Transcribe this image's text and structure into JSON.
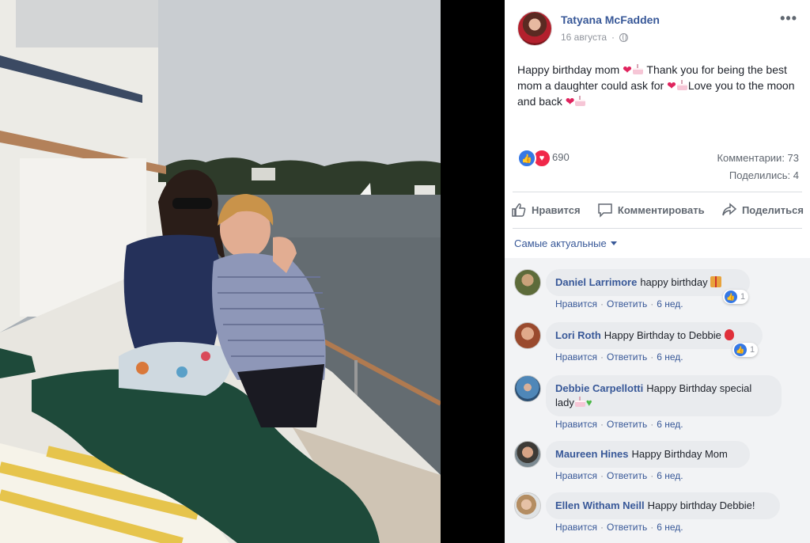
{
  "post": {
    "author": "Tatyana McFadden",
    "date": "16 августа",
    "text_segments": {
      "s1": "Happy birthday mom ",
      "s2": " Thank you for being the best mom a daughter could ask for ",
      "s3": "Love you to the moon and back "
    },
    "reaction_count": "690",
    "comments_label": "Комментарии: 73",
    "shares_label": "Поделились: 4"
  },
  "actions": {
    "like": "Нравится",
    "comment": "Комментировать",
    "share": "Поделиться"
  },
  "sort_label": "Самые актуальные",
  "comments": [
    {
      "author": "Daniel Larrimore",
      "text": "happy birthday",
      "like": "Нравится",
      "reply": "Ответить",
      "sep": "·",
      "time": "6 нед.",
      "reactions": "1"
    },
    {
      "author": "Lori Roth",
      "text": "Happy Birthday to Debbie",
      "like": "Нравится",
      "reply": "Ответить",
      "sep": "·",
      "time": "6 нед.",
      "reactions": "1"
    },
    {
      "author": "Debbie Carpellotti",
      "text": "Happy Birthday special lady",
      "like": "Нравится",
      "reply": "Ответить",
      "sep": "·",
      "time": "6 нед."
    },
    {
      "author": "Maureen Hines",
      "text": "Happy Birthday Mom",
      "like": "Нравится",
      "reply": "Ответить",
      "sep": "·",
      "time": "6 нед."
    },
    {
      "author": "Ellen Witham Neill",
      "text": "Happy birthday Debbie!",
      "like": "Нравится",
      "reply": "Ответить",
      "sep": "·",
      "time": "6 нед."
    }
  ],
  "colors": {
    "link_blue": "#385898",
    "like_blue": "#3578e5",
    "love_red": "#f0284a",
    "bubble_gray": "#e9ebee"
  }
}
